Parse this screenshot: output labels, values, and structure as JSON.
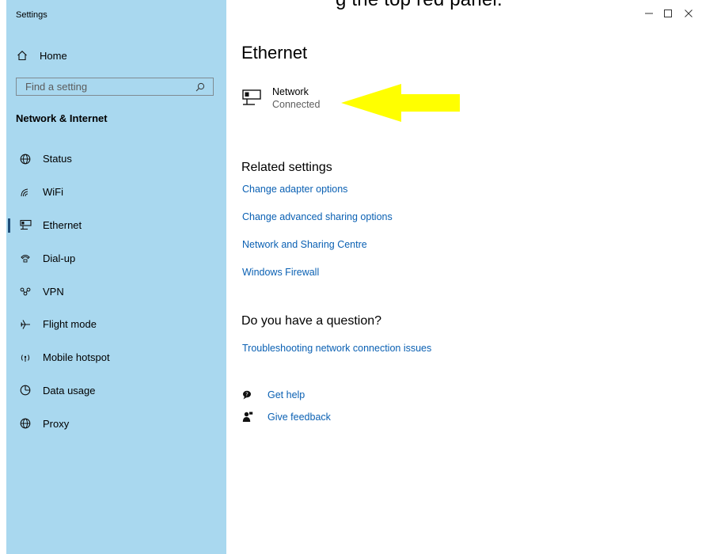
{
  "caption_fragment": "g the top red panel.",
  "app_title": "Settings",
  "sidebar": {
    "home_label": "Home",
    "search_placeholder": "Find a setting",
    "section_heading": "Network & Internet",
    "items": [
      {
        "label": "Status",
        "icon": "globe-icon"
      },
      {
        "label": "WiFi",
        "icon": "wifi-icon"
      },
      {
        "label": "Ethernet",
        "icon": "ethernet-icon",
        "active": true
      },
      {
        "label": "Dial-up",
        "icon": "dialup-icon"
      },
      {
        "label": "VPN",
        "icon": "vpn-icon"
      },
      {
        "label": "Flight mode",
        "icon": "airplane-icon"
      },
      {
        "label": "Mobile hotspot",
        "icon": "hotspot-icon"
      },
      {
        "label": "Data usage",
        "icon": "data-usage-icon"
      },
      {
        "label": "Proxy",
        "icon": "globe-icon"
      }
    ]
  },
  "window_controls": {
    "minimize": "minimize-icon",
    "maximize": "maximize-icon",
    "close": "close-icon"
  },
  "main": {
    "title": "Ethernet",
    "network": {
      "name": "Network",
      "status": "Connected",
      "icon": "ethernet-icon"
    },
    "annotation": {
      "shape": "arrow",
      "direction": "left",
      "color": "#ffff00"
    },
    "related_heading": "Related settings",
    "related_links": [
      "Change adapter options",
      "Change advanced sharing options",
      "Network and Sharing Centre",
      "Windows Firewall"
    ],
    "question_heading": "Do you have a question?",
    "question_link": "Troubleshooting network connection issues",
    "help_links": [
      {
        "label": "Get help",
        "icon": "help-chat-icon"
      },
      {
        "label": "Give feedback",
        "icon": "feedback-person-icon"
      }
    ]
  },
  "colors": {
    "sidebar_bg": "#a9d8ef",
    "link": "#0a60b3",
    "accent_bar": "#1f4e79",
    "arrow": "#ffff00"
  }
}
